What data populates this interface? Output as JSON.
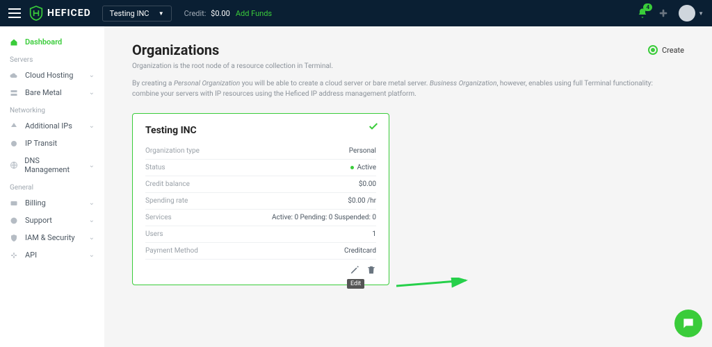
{
  "header": {
    "brand": "HEFICED",
    "org_selector": "Testing INC",
    "credit_label": "Credit:",
    "credit_amount": "$0.00",
    "add_funds": "Add Funds",
    "notification_count": "4"
  },
  "sidebar": {
    "dashboard": "Dashboard",
    "sections": {
      "servers": "Servers",
      "networking": "Networking",
      "general": "General"
    },
    "items": {
      "cloud_hosting": "Cloud Hosting",
      "bare_metal": "Bare Metal",
      "additional_ips": "Additional IPs",
      "ip_transit": "IP Transit",
      "dns": "DNS Management",
      "billing": "Billing",
      "support": "Support",
      "iam": "IAM & Security",
      "api": "API"
    }
  },
  "page": {
    "title": "Organizations",
    "create": "Create",
    "subtitle": "Organization is the root node of a resource collection in Terminal.",
    "desc_pre": "By creating a ",
    "desc_em1": "Personal Organization",
    "desc_mid": " you will be able to create a cloud server or bare metal server. ",
    "desc_em2": "Business Organization",
    "desc_post": ", however, enables using full Terminal functionality: combine your servers with IP resources using the Heficed IP address management platform."
  },
  "card": {
    "name": "Testing INC",
    "rows": {
      "type_label": "Organization type",
      "type_value": "Personal",
      "status_label": "Status",
      "status_value": "Active",
      "credit_label": "Credit balance",
      "credit_value": "$0.00",
      "spending_label": "Spending rate",
      "spending_value": "$0.00 /hr",
      "services_label": "Services",
      "services_value": "Active: 0 Pending: 0 Suspended: 0",
      "users_label": "Users",
      "users_value": "1",
      "payment_label": "Payment Method",
      "payment_value": "Creditcard"
    },
    "tooltip_edit": "Edit"
  }
}
